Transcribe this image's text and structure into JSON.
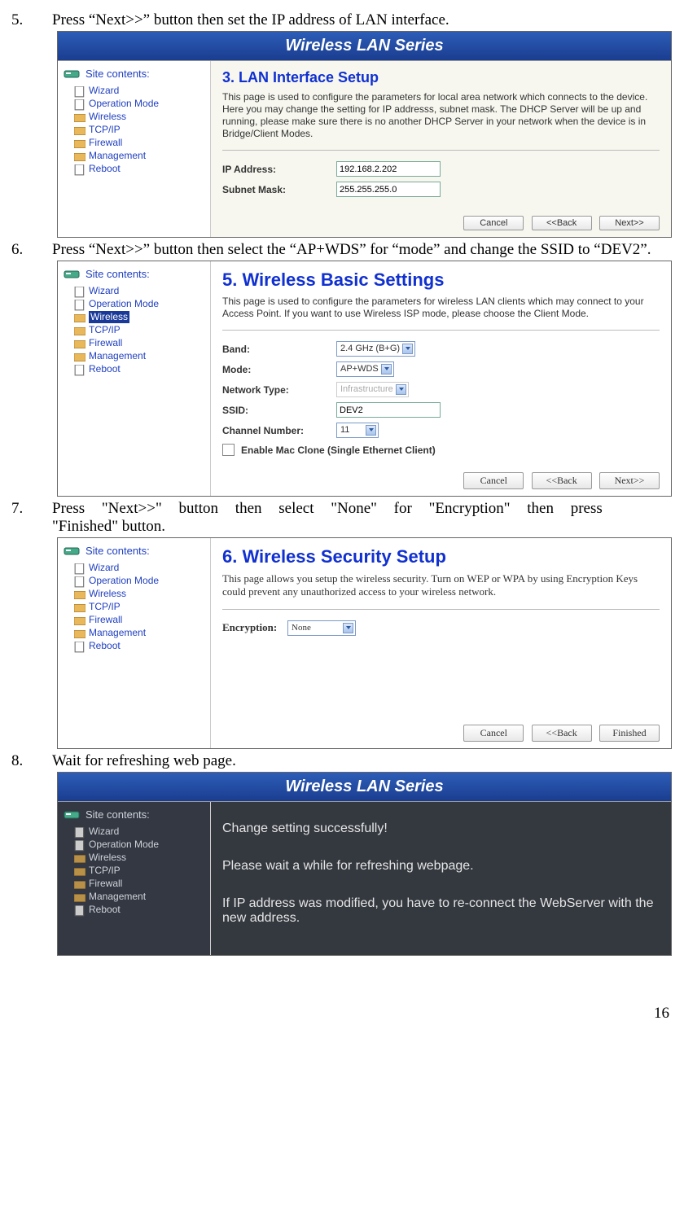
{
  "page_number": "16",
  "steps": {
    "s5": {
      "num": "5.",
      "text": "Press “Next>>” button then set the IP address of LAN interface."
    },
    "s6": {
      "num": "6.",
      "text": "Press “Next>>” button then select the “AP+WDS” for “mode” and change the SSID to “DEV2”."
    },
    "s7": {
      "num": "7.",
      "text": "Press “Next>>” button then select “None” for “Encryption” then press “Finished” button."
    },
    "s8": {
      "num": "8.",
      "text": "Wait for refreshing web page."
    }
  },
  "banner": "Wireless LAN Series",
  "sidebar": {
    "title": "Site contents:",
    "items": [
      "Wizard",
      "Operation Mode",
      "Wireless",
      "TCP/IP",
      "Firewall",
      "Management",
      "Reboot"
    ]
  },
  "panel3": {
    "title": "3. LAN Interface Setup",
    "desc": "This page is used to configure the parameters for local area network which connects to the device. Here you may change the setting for IP addresss, subnet mask. The DHCP Server will be up and running, please make sure there is no another DHCP Server in your network when the device is in Bridge/Client Modes.",
    "ip_label": "IP Address:",
    "ip_value": "192.168.2.202",
    "mask_label": "Subnet Mask:",
    "mask_value": "255.255.255.0",
    "btn_cancel": "Cancel",
    "btn_back": "<<Back",
    "btn_next": "Next>>"
  },
  "panel5": {
    "title": "5. Wireless Basic Settings",
    "desc": "This page is used to configure the parameters for wireless LAN clients which may connect to your Access Point. If you want to use Wireless ISP mode, please choose the Client Mode.",
    "band_label": "Band:",
    "band_value": "2.4 GHz (B+G)",
    "mode_label": "Mode:",
    "mode_value": "AP+WDS",
    "net_label": "Network Type:",
    "net_value": "Infrastructure",
    "ssid_label": "SSID:",
    "ssid_value": "DEV2",
    "chan_label": "Channel Number:",
    "chan_value": "11",
    "mac_label": "Enable Mac Clone (Single Ethernet Client)",
    "btn_cancel": "Cancel",
    "btn_back": "<<Back",
    "btn_next": "Next>>"
  },
  "panel6": {
    "title": "6. Wireless Security Setup",
    "desc": "This page allows you setup the wireless security. Turn on WEP or WPA by using Encryption Keys could prevent any unauthorized access to your wireless network.",
    "enc_label": "Encryption:",
    "enc_value": "None",
    "btn_cancel": "Cancel",
    "btn_back": "<<Back",
    "btn_finished": "Finished"
  },
  "panel_refresh": {
    "line1": "Change setting successfully!",
    "line2": "Please wait a while for refreshing webpage.",
    "line3": "If IP address was modified, you have to re-connect the WebServer with the new address."
  }
}
